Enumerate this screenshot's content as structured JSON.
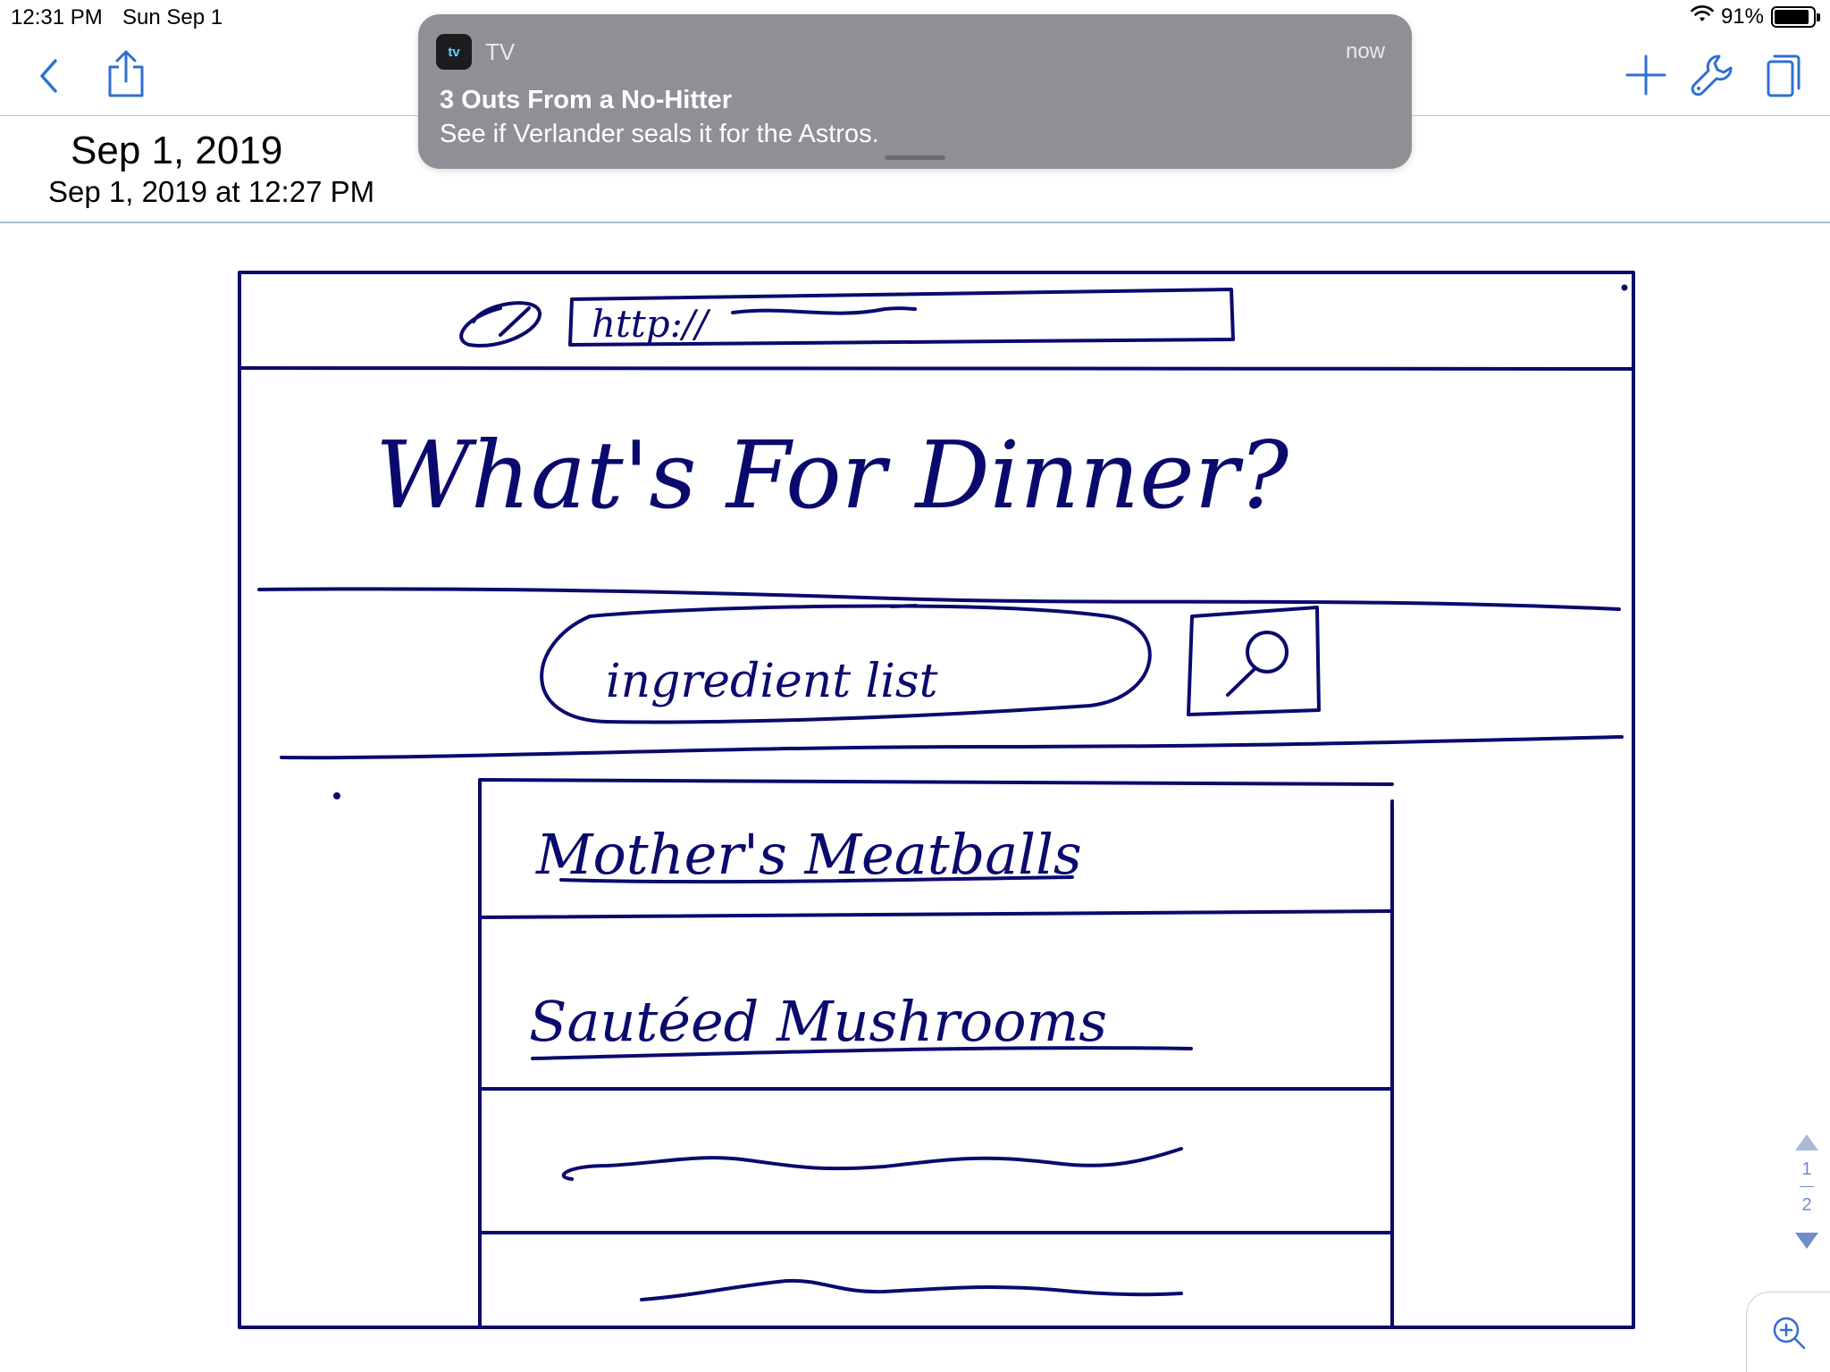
{
  "status_bar": {
    "time": "12:31 PM",
    "date": "Sun Sep 1",
    "battery": "91%",
    "battery_level": 0.91
  },
  "toolbar": {
    "icons": [
      "back-chevron-icon",
      "share-icon",
      "plus-icon",
      "wrench-icon",
      "pages-icon"
    ],
    "accent_color": "#2f6fd1"
  },
  "document": {
    "title": "Sep 1, 2019",
    "subtitle": "Sep 1, 2019 at 12:27 PM"
  },
  "notification": {
    "app_icon_label": "tv",
    "app_name": "TV",
    "time": "now",
    "title": "3 Outs From a No-Hitter",
    "body": "See if Verlander seals it for the Astros."
  },
  "sketch": {
    "ink_color": "#0a0a6e",
    "url_text": "http://",
    "heading": "What's For Dinner?",
    "search_placeholder": "ingredient list",
    "results": [
      "Mother's Meatballs",
      "Sautéed Mushrooms"
    ]
  },
  "page_indicator": {
    "current": "1",
    "total": "2"
  }
}
